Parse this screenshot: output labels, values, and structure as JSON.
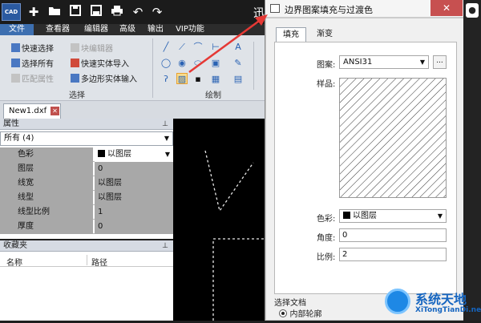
{
  "app": {
    "logo_text": "CAD",
    "title_fragment": "迅",
    "quick_access": [
      "new-icon",
      "open-folder-icon",
      "save-icon",
      "save-as-icon",
      "print-icon",
      "undo-icon",
      "redo-icon"
    ]
  },
  "menu": {
    "items": [
      {
        "label": "文件",
        "active": true
      },
      {
        "label": "查看器",
        "active": false
      },
      {
        "label": "编辑器",
        "active": false
      },
      {
        "label": "高级",
        "active": false
      },
      {
        "label": "输出",
        "active": false
      },
      {
        "label": "VIP功能",
        "active": false
      }
    ]
  },
  "ribbon": {
    "select_group": {
      "label": "选择",
      "quick_select": "快速选择",
      "select_all": "选择所有",
      "match_props": "匹配属性",
      "block_editor": "块编辑器",
      "quick_solid_import": "快速实体导入",
      "polygon_solid_input": "多边形实体输入"
    },
    "draw_group": {
      "label": "绘制"
    }
  },
  "document_tab": {
    "name": "New1.dxf"
  },
  "properties_panel": {
    "title": "属性",
    "pin": "ᵖ",
    "selector": "所有 (4)",
    "rows": [
      {
        "name": "色彩",
        "value": "以图层"
      },
      {
        "name": "图层",
        "value": "0"
      },
      {
        "name": "线宽",
        "value": "以图层"
      },
      {
        "name": "线型",
        "value": "以图层"
      },
      {
        "name": "线型比例",
        "value": "1"
      },
      {
        "name": "厚度",
        "value": "0"
      }
    ]
  },
  "favorites_panel": {
    "title": "收藏夹",
    "col_name": "名称",
    "col_path": "路径"
  },
  "dialog": {
    "title": "边界图案填充与过渡色",
    "close": "✕",
    "tabs": [
      {
        "label": "填充",
        "active": true
      },
      {
        "label": "渐变",
        "active": false
      }
    ],
    "pattern_label": "图案:",
    "pattern_value": "ANSI31",
    "browse_label": "...",
    "sample_label": "样品:",
    "color_label": "色彩:",
    "color_value": "以图层",
    "angle_label": "角度:",
    "angle_value": "0",
    "scale_label": "比例:",
    "scale_value": "2",
    "select_doc_label": "选择文档",
    "inner_outline_label": "内部轮廓"
  },
  "watermark": {
    "title": "系统天地",
    "url": "XiTongTianDi.net"
  },
  "colors": {
    "accent": "#3d6fb0",
    "canvas": "#000000",
    "annotation_arrow": "#e53935"
  }
}
